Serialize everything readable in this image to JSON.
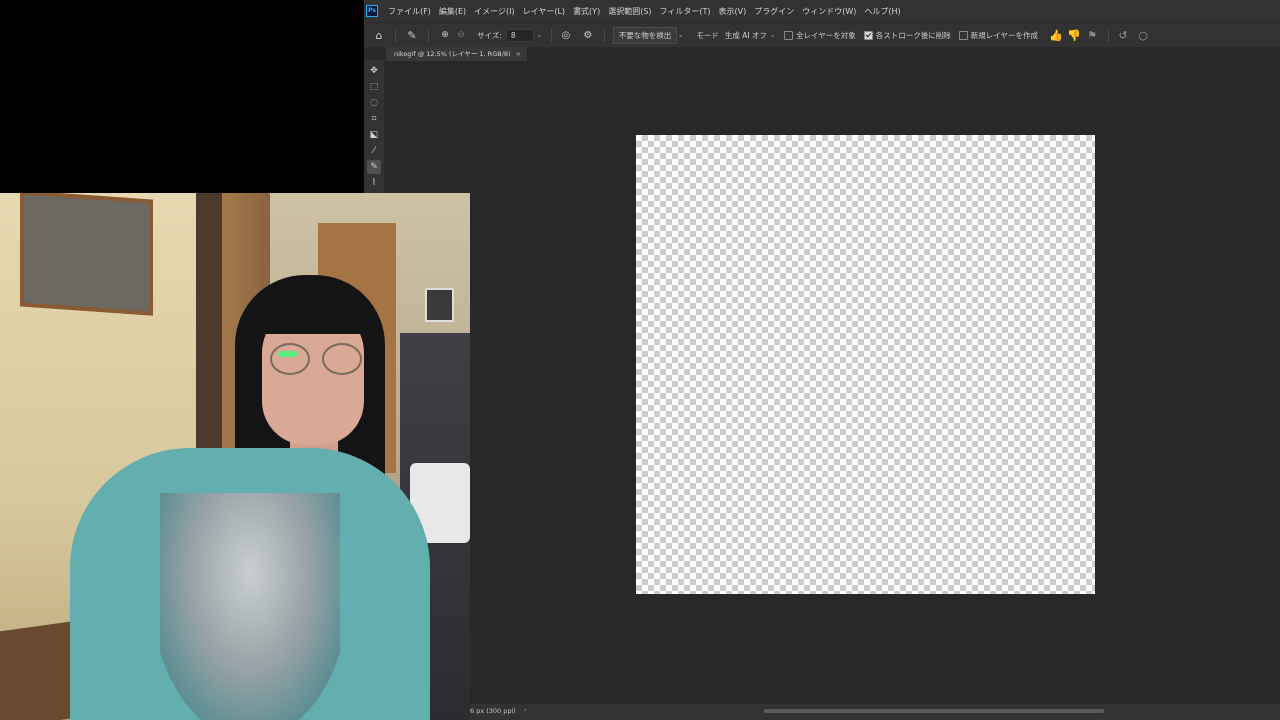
{
  "app": {
    "logo": "Ps"
  },
  "menubar": {
    "items": [
      "ファイル(F)",
      "編集(E)",
      "イメージ(I)",
      "レイヤー(L)",
      "書式(Y)",
      "選択範囲(S)",
      "フィルター(T)",
      "表示(V)",
      "プラグイン",
      "ウィンドウ(W)",
      "ヘルプ(H)"
    ]
  },
  "options": {
    "size_label": "サイズ:",
    "size_value": "8",
    "detect_button": "不要な物を検出",
    "mode_label": "モード",
    "mode_value": "生成 AI オフ",
    "all_layers": {
      "label": "全レイヤーを対象",
      "checked": false
    },
    "remove_after_stroke": {
      "label": "各ストローク後に削除",
      "checked": true
    },
    "new_layer": {
      "label": "新規レイヤーを作成",
      "checked": false
    }
  },
  "document": {
    "tab_title": "nikogif @ 12.5% (レイヤー 1, RGB/8)"
  },
  "status": {
    "text": "6 px (300 ppi)"
  },
  "tools": [
    "move-tool",
    "marquee-tool",
    "lasso-tool",
    "crop-tool",
    "object-select-tool",
    "eyedropper-tool",
    "remove-tool",
    "brush-tool"
  ]
}
